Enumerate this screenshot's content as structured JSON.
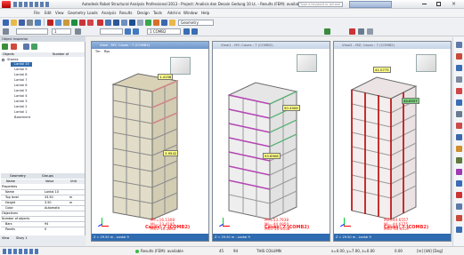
{
  "app": {
    "title": "Autodesk Robot Structural Analysis Professional 2013 - Project: Analisis dan Desain Gedung 10 Lt. - Results (FEM): available",
    "search_placeholder": "Type a keyword or phrase",
    "window_controls": [
      "minimize-icon",
      "maximize-icon",
      "close-icon"
    ]
  },
  "menu": {
    "items": [
      "File",
      "Edit",
      "View",
      "Geometry",
      "Loads",
      "Analysis",
      "Results",
      "Design",
      "Tools",
      "Add-ins",
      "Window",
      "Help"
    ]
  },
  "toolbar": {
    "combo1": "1",
    "combo2": "1 COMB2",
    "layout_combo": "Geometry"
  },
  "left_panel": {
    "object_inspector_title": "Object Inspector",
    "columns": [
      "Objects",
      "Number of"
    ],
    "tree": [
      {
        "label": "Stories",
        "level": 0
      },
      {
        "label": "Lantai 10",
        "level": 1,
        "selected": true
      },
      {
        "label": "Lantai 9",
        "level": 1
      },
      {
        "label": "Lantai 8",
        "level": 1
      },
      {
        "label": "Lantai 7",
        "level": 1
      },
      {
        "label": "Lantai 6",
        "level": 1
      },
      {
        "label": "Lantai 5",
        "level": 1
      },
      {
        "label": "Lantai 4",
        "level": 1
      },
      {
        "label": "Lantai 3",
        "level": 1
      },
      {
        "label": "Lantai 2",
        "level": 1
      },
      {
        "label": "Lantai 1",
        "level": 1
      },
      {
        "label": "Basement",
        "level": 1
      }
    ],
    "tabs": [
      "Geometry",
      "Groups"
    ],
    "props_columns": [
      "Name",
      "Value",
      "Unit"
    ],
    "props": [
      {
        "name": "Properties",
        "value": "",
        "unit": ""
      },
      {
        "name": "Name",
        "value": "Lantai 10",
        "unit": ""
      },
      {
        "name": "Top level",
        "value": "33.50",
        "unit": "m"
      },
      {
        "name": "Height",
        "value": "3.50",
        "unit": "m"
      },
      {
        "name": "Color",
        "value": "Automatic",
        "unit": ""
      },
      {
        "name": "Objectives",
        "value": "",
        "unit": ""
      },
      {
        "name": "Number of objects",
        "value": "",
        "unit": ""
      },
      {
        "name": "Bars",
        "value": "94",
        "unit": ""
      },
      {
        "name": "Panels",
        "value": "0",
        "unit": ""
      }
    ],
    "bottom_tab": "Stories",
    "view_tabs": [
      "View",
      "Story 1"
    ]
  },
  "views": [
    {
      "title": "View - MY; Cases : 7 (COMB2)",
      "sub": [
        "Tm",
        "Rys"
      ],
      "labels": [
        {
          "text": "1.4158"
        },
        {
          "text": "3.9542"
        },
        {
          "text": "-11.4680"
        }
      ],
      "red_lines": [
        "MY=16.1308",
        "Mi=-23.4195",
        "Mx=-16.5842"
      ],
      "case": "Cases: 7 (COMB2)",
      "footer": "Z = 29.50 m - Lantai 9"
    },
    {
      "title": "View1 - MY; Cases : 7 (COMB2)",
      "sub": [],
      "labels": [
        {
          "text": "50.4906"
        },
        {
          "text": "53.6908"
        }
      ],
      "red_lines": [
        "MY=53.7938",
        "Mi=-44.0850",
        "Mx=-20.0050"
      ],
      "case": "Cases: 7 (COMB2)",
      "footer": "Z = 29.50 m - Lantai 9"
    },
    {
      "title": "View2 - MZ; Cases : 7 (COMB2)",
      "sub": [],
      "labels": [
        {
          "text": "41.0775"
        },
        {
          "text": "44.6557"
        }
      ],
      "red_lines": [
        "MZ=44.6557",
        "Mi=-44.6775",
        "Mx=-44.6557"
      ],
      "case": "Cases: 7 (COMB2)",
      "footer": "Z = 29.50 m - Lantai 9"
    }
  ],
  "status": {
    "results": "Results (FEM): available",
    "nodes": "45",
    "bars": "94",
    "section": "THIS COLUMN",
    "coords": "x=0.00, y=7.00, z=0.00",
    "angle": "0.00",
    "units": "[m] [kN] [Deg]",
    "accent": "#2f6bb0"
  }
}
